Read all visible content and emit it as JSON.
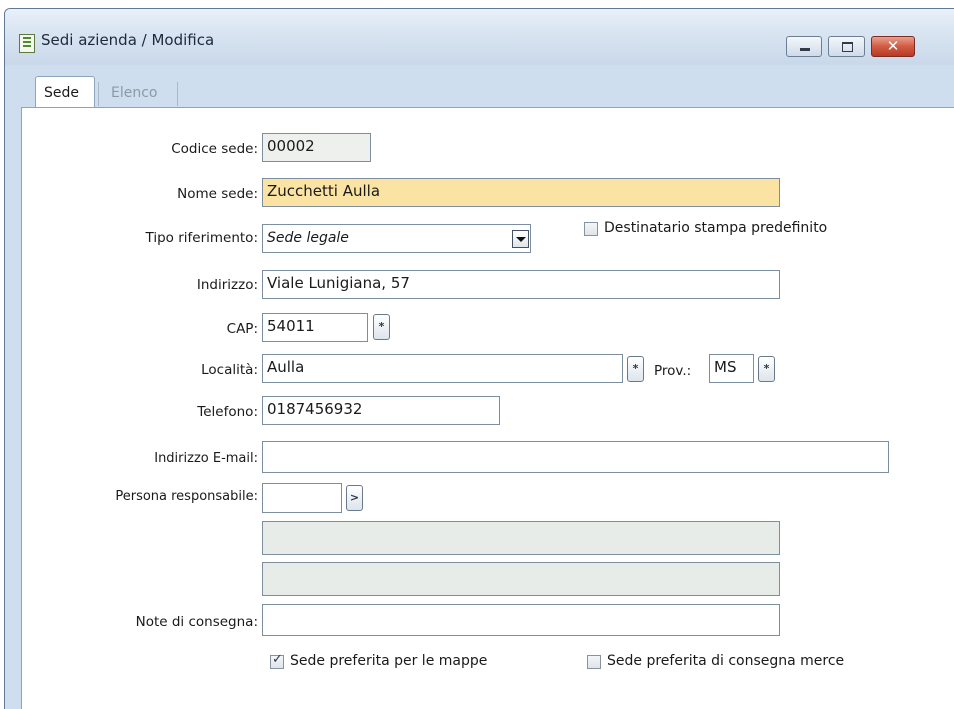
{
  "window": {
    "title": "Sedi azienda / Modifica",
    "icons": [
      "document-icon",
      "minimize-icon",
      "maximize-icon",
      "close-icon"
    ],
    "close_glyph": "✕"
  },
  "tabs": [
    {
      "label": "Sede",
      "active": true
    },
    {
      "label": "Elenco",
      "active": false
    }
  ],
  "form": {
    "codice_sede": {
      "label": "Codice sede:",
      "value": "00002"
    },
    "nome_sede": {
      "label": "Nome sede:",
      "value": "Zucchetti Aulla"
    },
    "tipo_riferimento": {
      "label": "Tipo riferimento:",
      "value": "Sede legale"
    },
    "destinatario_stampa": {
      "label": "Destinatario stampa predefinito",
      "checked": false
    },
    "indirizzo": {
      "label": "Indirizzo:",
      "value": "Viale Lunigiana, 57"
    },
    "cap": {
      "label": "CAP:",
      "value": "54011"
    },
    "localita": {
      "label": "Località:",
      "value": "Aulla"
    },
    "prov": {
      "label": "Prov.:",
      "value": "MS"
    },
    "telefono": {
      "label": "Telefono:",
      "value": "0187456932"
    },
    "email": {
      "label": "Indirizzo E-mail:",
      "value": ""
    },
    "persona_responsabile": {
      "label": "Persona responsabile:",
      "value": "",
      "extra1": "",
      "extra2": ""
    },
    "note_consegna": {
      "label": "Note di consegna:",
      "value": ""
    },
    "sede_preferita_mappe": {
      "label": "Sede preferita per le mappe",
      "checked": true
    },
    "sede_preferita_consegna": {
      "label": "Sede preferita di consegna merce",
      "checked": false
    }
  },
  "glyphs": {
    "zoom_button": "*",
    "link_button": ">",
    "check": "✓"
  },
  "colors": {
    "highlight_field": "#fbe3a3",
    "readonly_field": "#eef0ee",
    "window_bg": "#cfdeee"
  }
}
